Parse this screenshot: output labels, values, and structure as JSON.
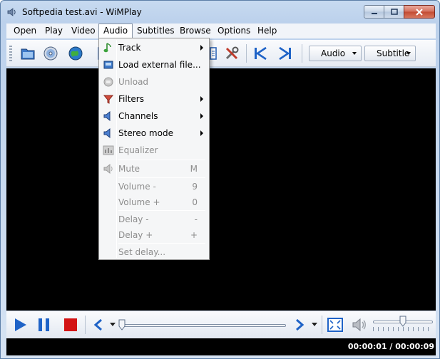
{
  "window": {
    "title": "Softpedia test.avi - WiMPlay"
  },
  "menubar": {
    "items": [
      {
        "label": "Open"
      },
      {
        "label": "Play"
      },
      {
        "label": "Video"
      },
      {
        "label": "Audio"
      },
      {
        "label": "Subtitles"
      },
      {
        "label": "Browse"
      },
      {
        "label": "Options"
      },
      {
        "label": "Help"
      }
    ]
  },
  "toolbar": {
    "audio_dropdown": "Audio",
    "subtitle_dropdown": "Subtitle"
  },
  "audio_menu": {
    "items": [
      {
        "label": "Track",
        "enabled": true,
        "submenu": true,
        "icon": "music-note-icon"
      },
      {
        "label": "Load external file...",
        "enabled": true,
        "icon": "load-file-icon"
      },
      {
        "label": "Unload",
        "enabled": false,
        "icon": "unload-icon"
      },
      {
        "label": "Filters",
        "enabled": true,
        "submenu": true,
        "icon": "filters-icon"
      },
      {
        "label": "Channels",
        "enabled": true,
        "submenu": true,
        "icon": "speaker-icon"
      },
      {
        "label": "Stereo mode",
        "enabled": true,
        "submenu": true,
        "icon": "speaker-icon"
      },
      {
        "label": "Equalizer",
        "enabled": false,
        "icon": "equalizer-icon"
      },
      {
        "label": "Mute",
        "shortcut": "M",
        "enabled": false,
        "icon": "mute-icon"
      },
      {
        "label": "Volume -",
        "shortcut": "9",
        "enabled": false
      },
      {
        "label": "Volume +",
        "shortcut": "0",
        "enabled": false
      },
      {
        "label": "Delay -",
        "shortcut": "-",
        "enabled": false
      },
      {
        "label": "Delay +",
        "shortcut": "+",
        "enabled": false
      },
      {
        "label": "Set delay...",
        "enabled": false
      }
    ]
  },
  "playback": {
    "seek_fraction": 0.0,
    "volume_fraction": 0.5
  },
  "status": {
    "time": "00:00:01 / 00:00:09"
  },
  "colors": {
    "accent_blue": "#1f63c7",
    "stop_red": "#d31414",
    "video_bg": "#000000"
  }
}
